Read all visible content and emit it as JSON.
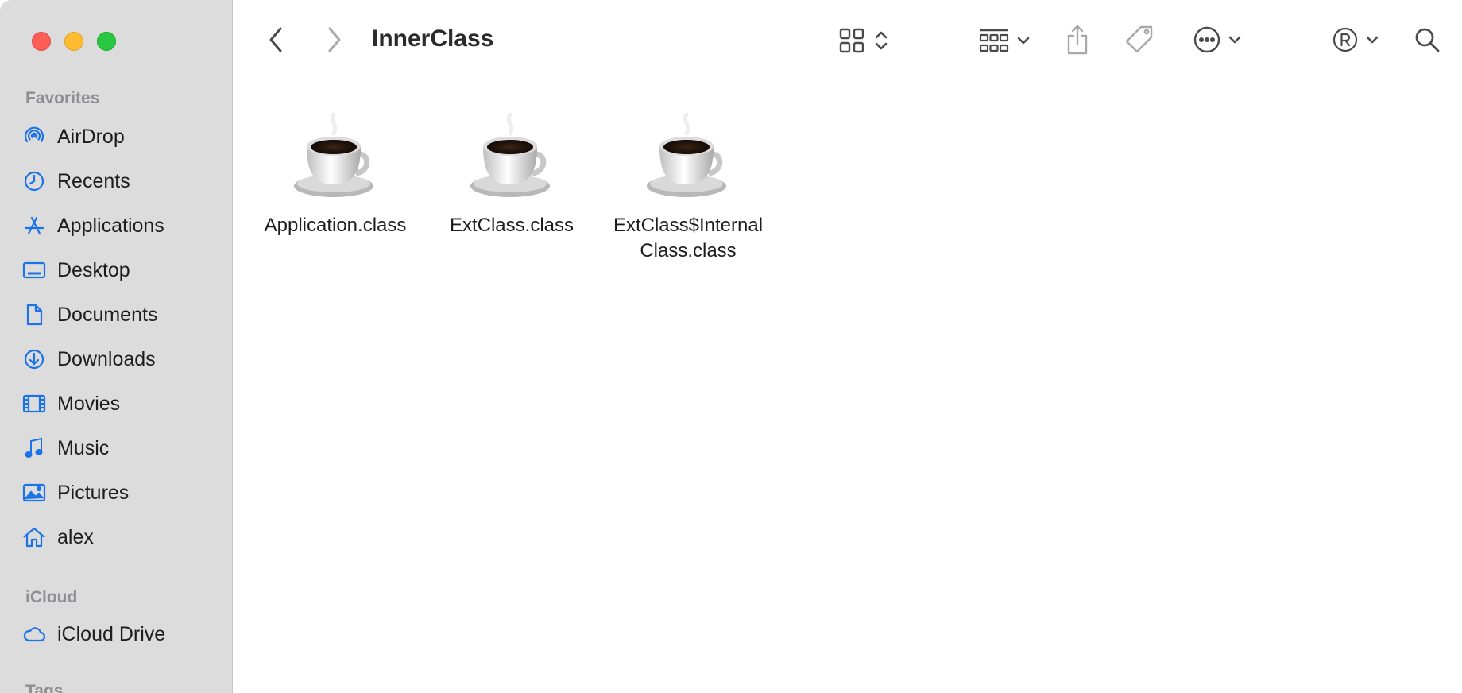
{
  "window": {
    "title": "InnerClass"
  },
  "colors": {
    "accent": "#1a73e8",
    "sidebar_bg": "#dcdcdc",
    "header_text": "#8e8e93"
  },
  "sidebar": {
    "favorites_header": "Favorites",
    "favorites": [
      {
        "label": "AirDrop",
        "icon": "airdrop-icon"
      },
      {
        "label": "Recents",
        "icon": "clock-icon"
      },
      {
        "label": "Applications",
        "icon": "applications-icon"
      },
      {
        "label": "Desktop",
        "icon": "desktop-icon"
      },
      {
        "label": "Documents",
        "icon": "document-icon"
      },
      {
        "label": "Downloads",
        "icon": "download-icon"
      },
      {
        "label": "Movies",
        "icon": "film-icon"
      },
      {
        "label": "Music",
        "icon": "music-note-icon"
      },
      {
        "label": "Pictures",
        "icon": "photo-icon"
      },
      {
        "label": "alex",
        "icon": "home-icon"
      }
    ],
    "icloud_header": "iCloud",
    "icloud": [
      {
        "label": "iCloud Drive",
        "icon": "cloud-icon"
      }
    ],
    "tags_header": "Tags"
  },
  "toolbar": {
    "back_icon": "chevron-left-icon",
    "forward_icon": "chevron-right-icon",
    "view_icon": "grid-view-icon",
    "group_icon": "group-icon",
    "share_icon": "share-icon",
    "tag_icon": "tag-icon",
    "action_icon": "ellipsis-circle-icon",
    "registered_icon": "registered-icon",
    "search_icon": "search-icon"
  },
  "files": [
    {
      "name": "Application.class",
      "icon": "coffee-cup-icon"
    },
    {
      "name": "ExtClass.class",
      "icon": "coffee-cup-icon"
    },
    {
      "name": "ExtClass$Internal Class.class",
      "icon": "coffee-cup-icon"
    }
  ]
}
